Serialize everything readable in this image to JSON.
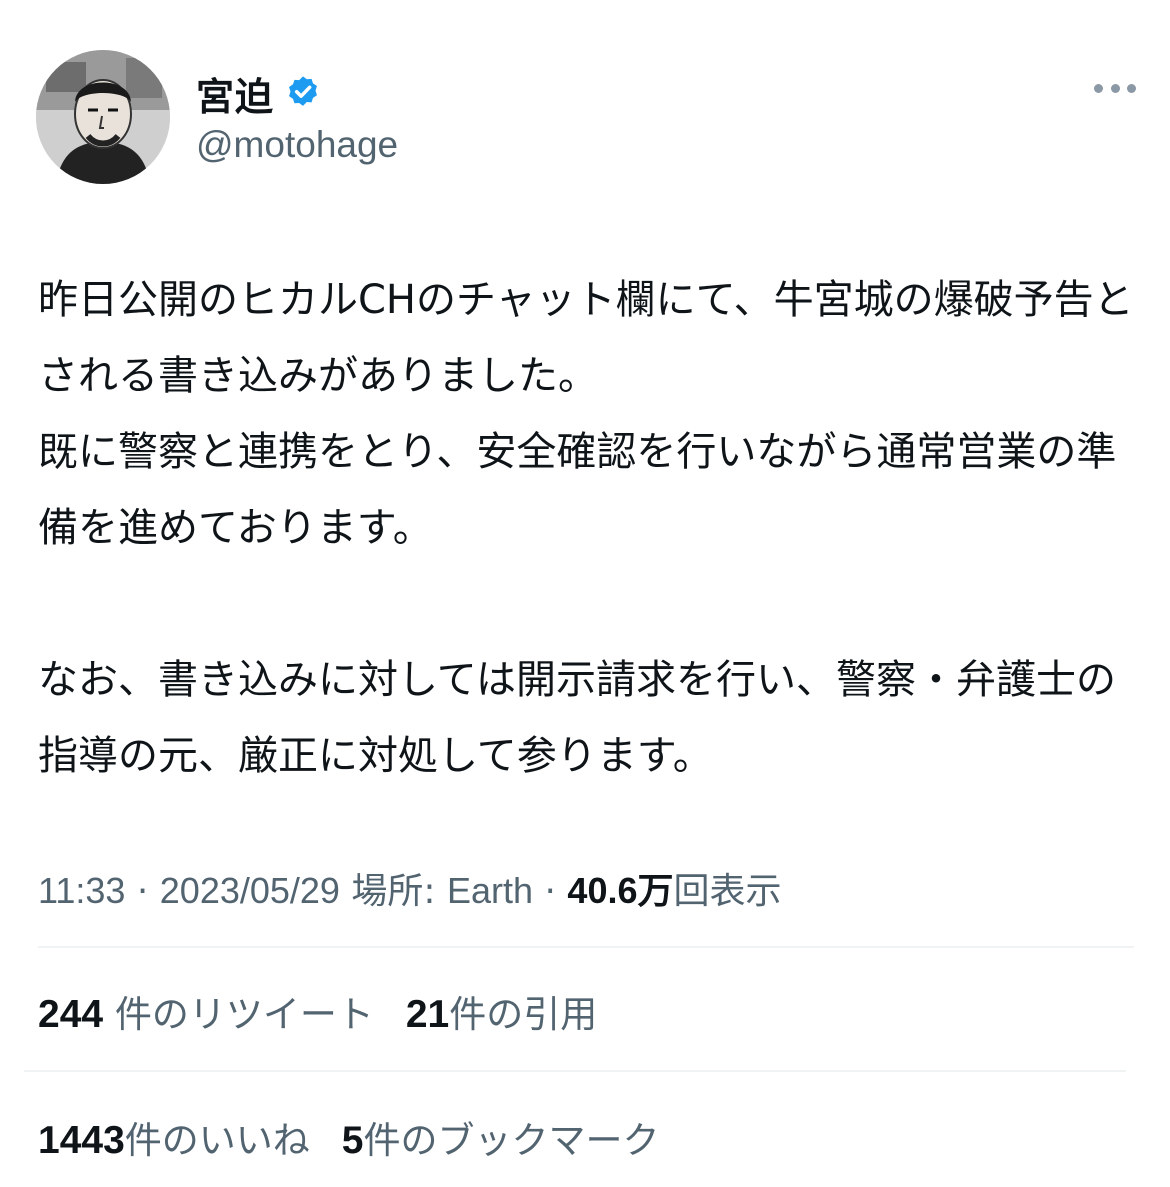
{
  "author": {
    "display_name": "宮迫",
    "handle": "@motohage",
    "verified": true,
    "verified_color": "#1d9bf0",
    "avatar_icon": "avatar-photo"
  },
  "more_icon": "more-horizontal-icon",
  "tweet": {
    "text": "昨日公開のヒカルCHのチャット欄にて、牛宮城の爆破予告とされる書き込みがありました。\n既に警察と連携をとり、安全確認を行いながら通常営業の準備を進めております。\n\nなお、書き込みに対しては開示請求を行い、警察・弁護士の指導の元、厳正に対処して参ります。"
  },
  "meta": {
    "time": "11:33",
    "separator": "·",
    "date": "2023/05/29",
    "location_label": "場所:",
    "location": "Earth",
    "views_count": "40.6万",
    "views_label": "回表示"
  },
  "stats": {
    "retweets_count": "244",
    "retweets_label": "件のリツイート",
    "quotes_count": "21",
    "quotes_label": "件の引用",
    "likes_count": "1443",
    "likes_label": "件のいいね",
    "bookmarks_count": "5",
    "bookmarks_label": "件のブックマーク"
  },
  "colors": {
    "text_primary": "#0f1419",
    "text_secondary": "#536471",
    "divider": "#eff3f4"
  }
}
